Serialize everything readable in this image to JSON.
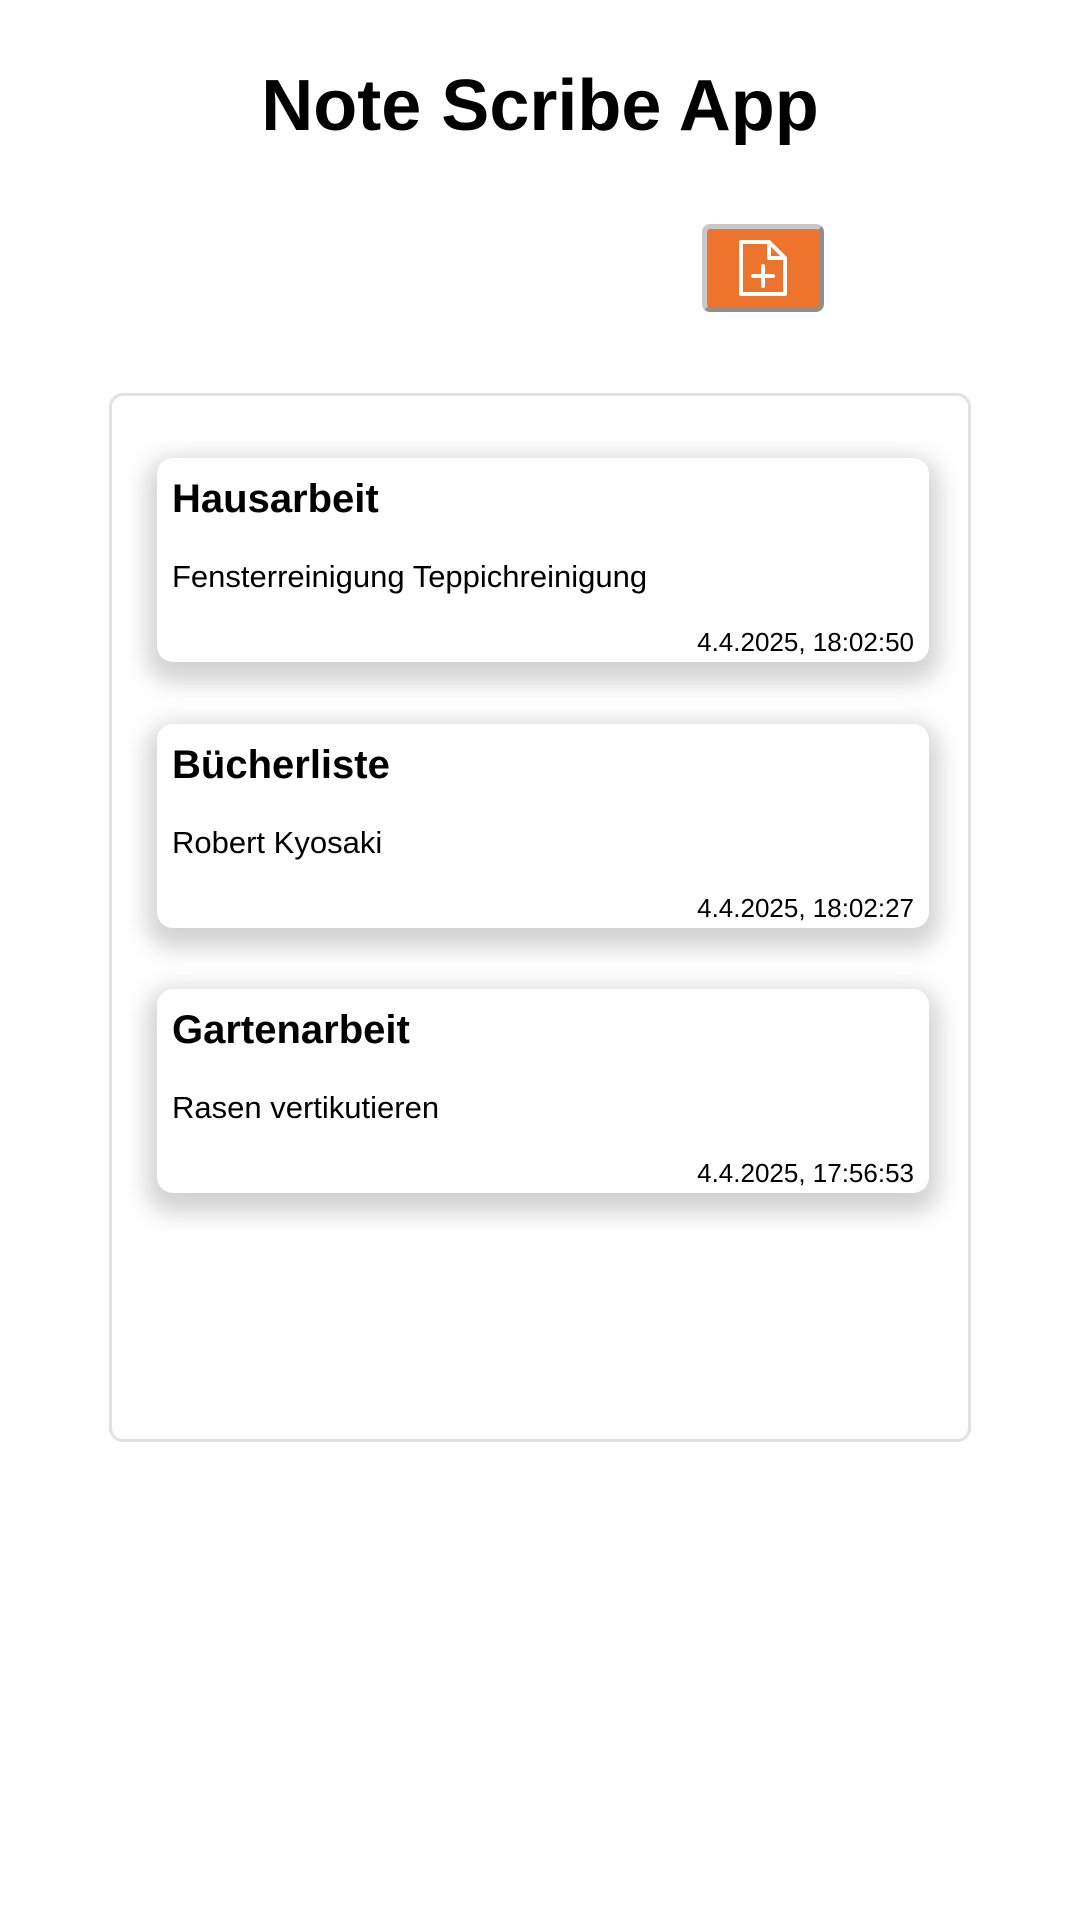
{
  "app": {
    "title": "Note Scribe App"
  },
  "toolbar": {
    "add_note_icon": "file-plus-icon",
    "accent_color": "#ec742c"
  },
  "notes": [
    {
      "title": "Hausarbeit",
      "body": "Fensterreinigung Teppichreinigung",
      "timestamp": "4.4.2025, 18:02:50"
    },
    {
      "title": "Bücherliste",
      "body": "Robert Kyosaki",
      "timestamp": "4.4.2025, 18:02:27"
    },
    {
      "title": "Gartenarbeit",
      "body": "Rasen vertikutieren",
      "timestamp": "4.4.2025, 17:56:53"
    }
  ]
}
